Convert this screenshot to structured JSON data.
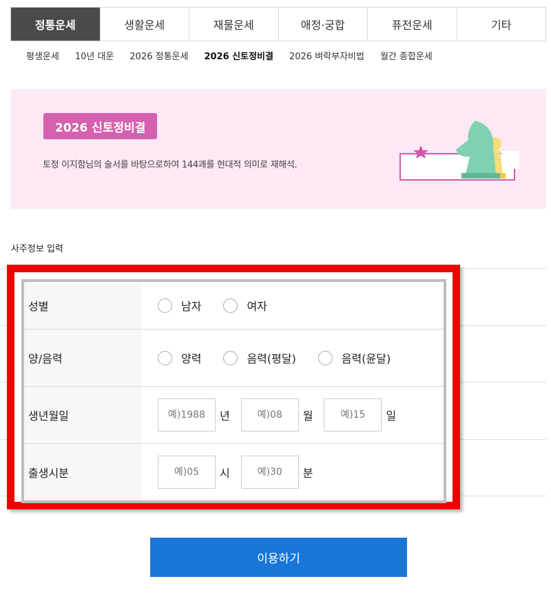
{
  "top_tabs": [
    {
      "label": "정통운세",
      "active": true
    },
    {
      "label": "생활운세",
      "active": false
    },
    {
      "label": "재물운세",
      "active": false
    },
    {
      "label": "애정·궁합",
      "active": false
    },
    {
      "label": "퓨전운세",
      "active": false
    },
    {
      "label": "기타",
      "active": false
    }
  ],
  "sub_menu": [
    {
      "label": "평생운세",
      "active": false
    },
    {
      "label": "10년 대운",
      "active": false
    },
    {
      "label": "2026 정통운세",
      "active": false
    },
    {
      "label": "2026 신토정비결",
      "active": true
    },
    {
      "label": "2026 벼락부자비법",
      "active": false
    },
    {
      "label": "월간 종합운세",
      "active": false
    }
  ],
  "banner": {
    "badge": "2026 신토정비결",
    "description": "토정 이지함님의 술서를 바탕으로하여 144괘를 현대적 의미로 재해석.",
    "background_color": "#fde8f6",
    "badge_color": "#d561ae",
    "art_icon": "chess-knight-pawn-illustration"
  },
  "section_title": "사주정보 입력",
  "form": {
    "gender": {
      "label": "성별",
      "options": [
        "남자",
        "여자"
      ]
    },
    "calendar": {
      "label": "양/음력",
      "options": [
        "양력",
        "음력(평달)",
        "음력(윤달)"
      ]
    },
    "birth_date": {
      "label": "생년월일",
      "year_placeholder": "예)1988",
      "year_unit": "년",
      "month_placeholder": "예)08",
      "month_unit": "월",
      "day_placeholder": "예)15",
      "day_unit": "일"
    },
    "birth_time": {
      "label": "출생시분",
      "hour_placeholder": "예)05",
      "hour_unit": "시",
      "minute_placeholder": "예)30",
      "minute_unit": "분"
    }
  },
  "highlight_color": "#f00000",
  "submit": {
    "label": "이용하기",
    "color": "#1976d8"
  }
}
